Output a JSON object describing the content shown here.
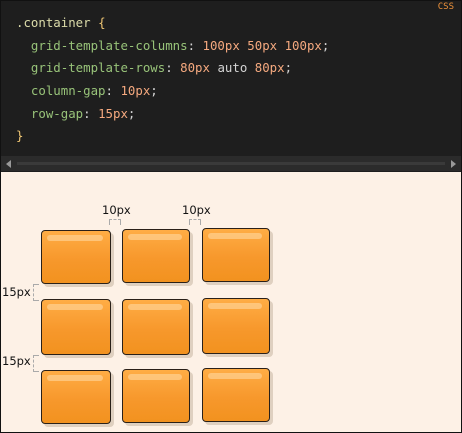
{
  "code_panel": {
    "language": "CSS",
    "selector": ".container",
    "open_brace": "{",
    "close_brace": "}",
    "declarations": [
      {
        "property": "grid-template-columns",
        "values": [
          "100px",
          "50px",
          "100px"
        ]
      },
      {
        "property": "grid-template-rows",
        "values": [
          "80px",
          "auto",
          "80px"
        ]
      },
      {
        "property": "column-gap",
        "values": [
          "10px"
        ]
      },
      {
        "property": "row-gap",
        "values": [
          "15px"
        ]
      }
    ]
  },
  "demo": {
    "column_gap_label": "10px",
    "row_gap_label": "15px",
    "grid": {
      "rows": 3,
      "columns": 3
    },
    "cell_color": "#f7982c"
  }
}
